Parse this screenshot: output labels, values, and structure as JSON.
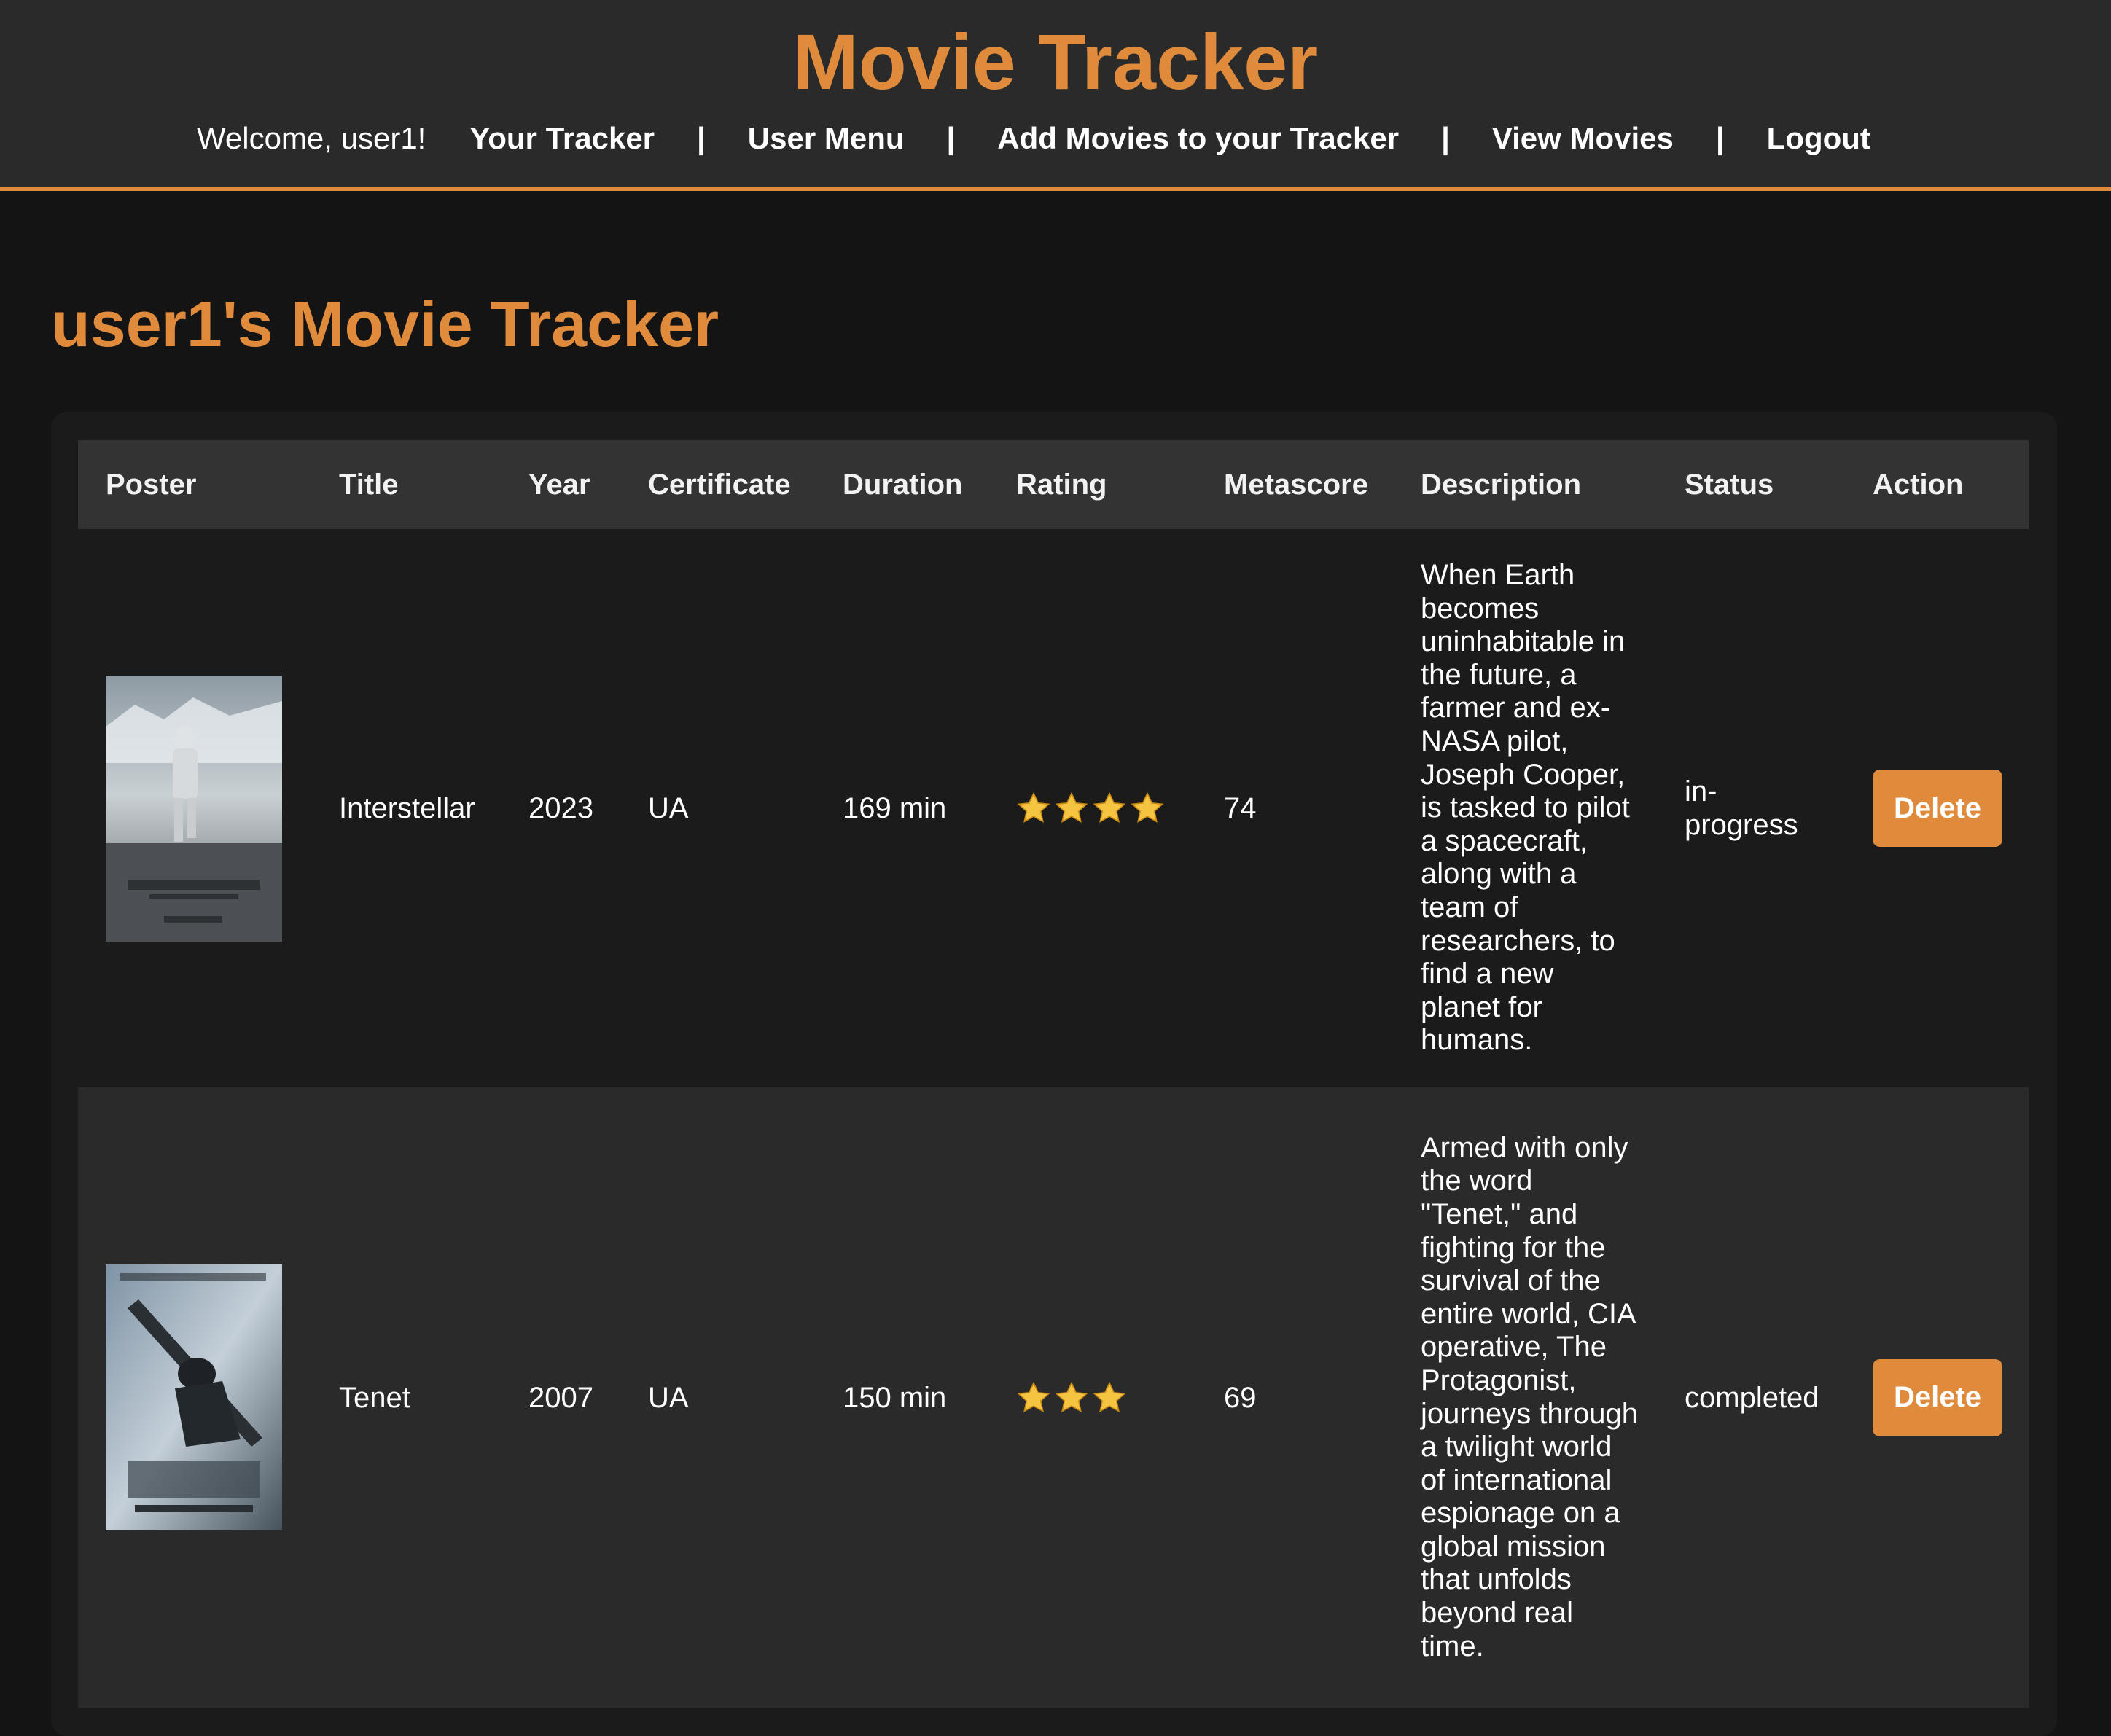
{
  "app": {
    "title": "Movie Tracker",
    "accent_color": "#e08a3c"
  },
  "nav": {
    "welcome": "Welcome, user1!",
    "links": [
      "Your Tracker",
      "User Menu",
      "Add Movies to your Tracker",
      "View Movies",
      "Logout"
    ],
    "separator": "|"
  },
  "page": {
    "heading": "user1's Movie Tracker"
  },
  "table": {
    "columns": [
      "Poster",
      "Title",
      "Year",
      "Certificate",
      "Duration",
      "Rating",
      "Metascore",
      "Description",
      "Status",
      "Action"
    ],
    "rows": [
      {
        "poster_icon": "interstellar-poster",
        "title": "Interstellar",
        "year": "2023",
        "certificate": "UA",
        "duration": "169 min",
        "rating_stars": 4,
        "metascore": "74",
        "description": "When Earth becomes uninhabitable in the future, a farmer and ex-NASA pilot, Joseph Cooper, is tasked to pilot a spacecraft, along with a team of researchers, to find a new planet for humans.",
        "status": "in-progress",
        "action": "Delete"
      },
      {
        "poster_icon": "tenet-poster",
        "title": "Tenet",
        "year": "2007",
        "certificate": "UA",
        "duration": "150 min",
        "rating_stars": 3,
        "metascore": "69",
        "description": "Armed with only the word \"Tenet,\" and fighting for the survival of the entire world, CIA operative, The Protagonist, journeys through a twilight world of international espionage on a global mission that unfolds beyond real time.",
        "status": "completed",
        "action": "Delete"
      }
    ]
  }
}
